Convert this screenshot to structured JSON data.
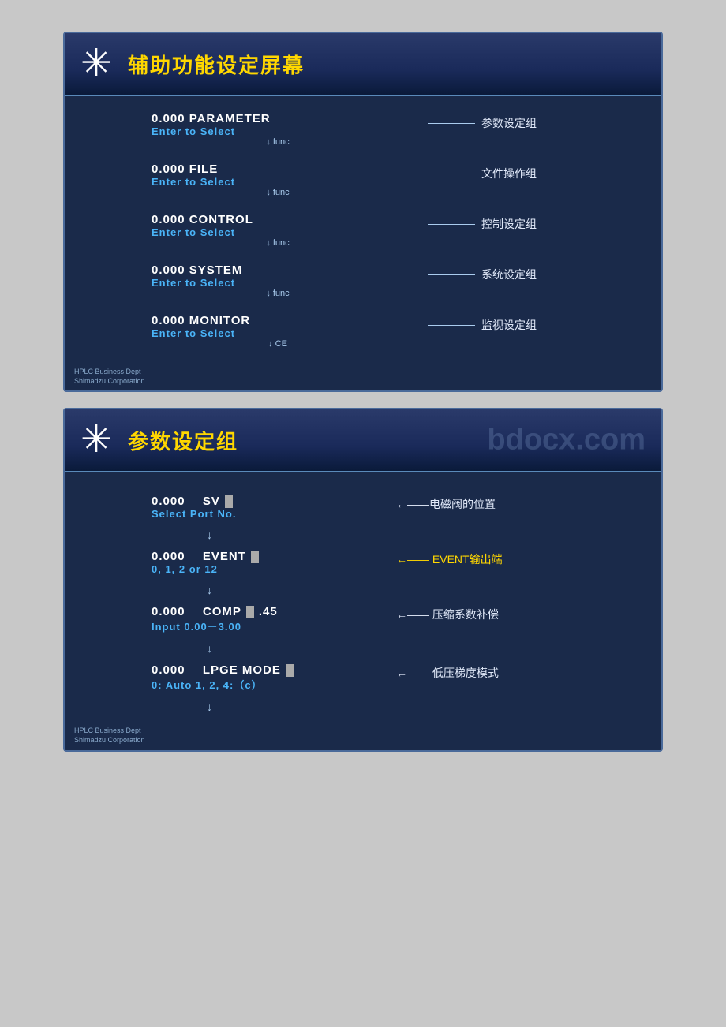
{
  "panel1": {
    "title": "辅助功能设定屏幕",
    "watermark": "",
    "items": [
      {
        "main": "0.000  PARAMETER",
        "sub": "Enter  to  Select",
        "func": "↓ func",
        "label_cn": "参数设定组"
      },
      {
        "main": "0.000  FILE",
        "sub": "Enter  to  Select",
        "func": "↓ func",
        "label_cn": "文件操作组"
      },
      {
        "main": "0.000  CONTROL",
        "sub": "Enter  to  Select",
        "func": "↓ func",
        "label_cn": "控制设定组"
      },
      {
        "main": "0.000  SYSTEM",
        "sub": "Enter  to  Select",
        "func": "↓ func",
        "label_cn": "系统设定组"
      },
      {
        "main": "0.000  MONITOR",
        "sub": "Enter  to  Select",
        "func": "↓ CE",
        "label_cn": "监视设定组"
      }
    ],
    "footer": {
      "line1": "HPLC Business Dept",
      "line2": "Shimadzu Corporation"
    }
  },
  "panel2": {
    "title": "参数设定组",
    "watermark": "bdocx.com",
    "items": [
      {
        "main_prefix": "0.000",
        "main_key": "SV",
        "has_cursor": true,
        "sub": "Select  Port  No.",
        "label_cn": "←——电磁阀的位置"
      },
      {
        "main_prefix": "0.000",
        "main_key": "EVENT",
        "has_cursor": true,
        "sub": "0, 1, 2  or  12",
        "label_cn": "←—— EVENT输出端"
      },
      {
        "main_prefix": "0.000",
        "main_key": "COMP",
        "extra": ".45",
        "has_cursor": true,
        "sub": "Input  0.00－3.00",
        "label_cn": "←—— 压缩系数补偿"
      },
      {
        "main_prefix": "0.000",
        "main_key": "LPGE  MODE",
        "has_cursor": true,
        "sub": "0: Auto  1, 2, 4:（c）",
        "label_cn": "←—— 低压梯度模式"
      }
    ],
    "footer": {
      "line1": "HPLC Business Dept",
      "line2": "Shimadzu Corporation"
    }
  },
  "icons": {
    "star": "✳",
    "arrow_down": "↓"
  }
}
